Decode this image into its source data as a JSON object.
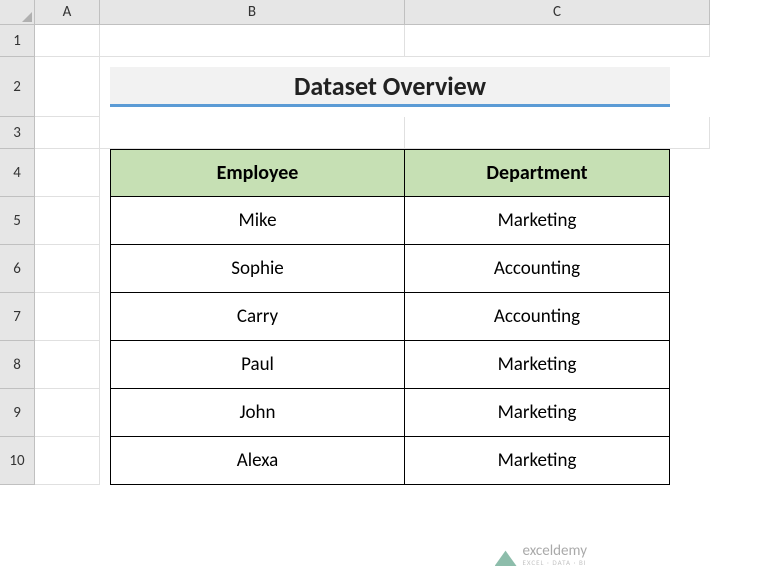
{
  "columns": [
    "A",
    "B",
    "C"
  ],
  "rows": [
    "1",
    "2",
    "3",
    "4",
    "5",
    "6",
    "7",
    "8",
    "9",
    "10"
  ],
  "title": "Dataset Overview",
  "table": {
    "headers": {
      "employee": "Employee",
      "department": "Department"
    },
    "data": [
      {
        "employee": "Mike",
        "department": "Marketing"
      },
      {
        "employee": "Sophie",
        "department": "Accounting"
      },
      {
        "employee": "Carry",
        "department": "Accounting"
      },
      {
        "employee": "Paul",
        "department": "Marketing"
      },
      {
        "employee": "John",
        "department": "Marketing"
      },
      {
        "employee": "Alexa",
        "department": "Marketing"
      }
    ]
  },
  "watermark": {
    "main": "exceldemy",
    "sub": "EXCEL · DATA · BI"
  },
  "chart_data": {
    "type": "table",
    "title": "Dataset Overview",
    "columns": [
      "Employee",
      "Department"
    ],
    "rows": [
      [
        "Mike",
        "Marketing"
      ],
      [
        "Sophie",
        "Accounting"
      ],
      [
        "Carry",
        "Accounting"
      ],
      [
        "Paul",
        "Marketing"
      ],
      [
        "John",
        "Marketing"
      ],
      [
        "Alexa",
        "Marketing"
      ]
    ]
  }
}
